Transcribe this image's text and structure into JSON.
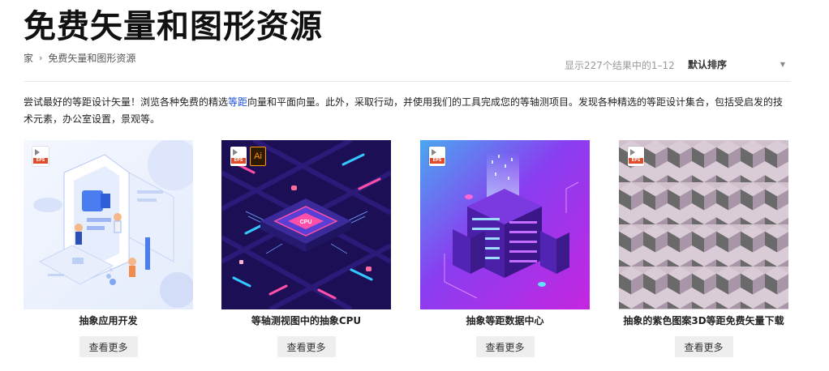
{
  "page": {
    "title": "免费矢量和图形资源"
  },
  "breadcrumb": {
    "home": "家",
    "separator": "›",
    "current": "免费矢量和图形资源"
  },
  "results": {
    "count_text": "显示227个结果中的1–12"
  },
  "sort": {
    "selected": "默认排序"
  },
  "description": {
    "part1": "尝试最好的等距设计矢量！浏览各种免费的精选",
    "link": "等距",
    "part2": "向量和平面向量。此外，采取行动，并使用我们的工具完成您的等轴测项目。发现各种精选的等距设计集合，包括受启发的技术元素，办公室设置，景观等。"
  },
  "badges": {
    "eps": "EPS",
    "ai": "Ai"
  },
  "cards": [
    {
      "title": "抽象应用开发",
      "button": "查看更多",
      "formats": [
        "EPS"
      ]
    },
    {
      "title": "等轴测视图中的抽象CPU",
      "button": "查看更多",
      "formats": [
        "EPS",
        "Ai"
      ],
      "chip_text": "CPU"
    },
    {
      "title": "抽象等距数据中心",
      "button": "查看更多",
      "formats": [
        "EPS"
      ]
    },
    {
      "title": "抽象的紫色图案3D等距免费矢量下载",
      "button": "查看更多",
      "formats": [
        "EPS"
      ]
    }
  ],
  "colors": {
    "link": "#1a4fd8",
    "button_bg": "#eeeeee",
    "eps_badge": "#e24b2a",
    "ai_badge": "#ff9a00"
  }
}
